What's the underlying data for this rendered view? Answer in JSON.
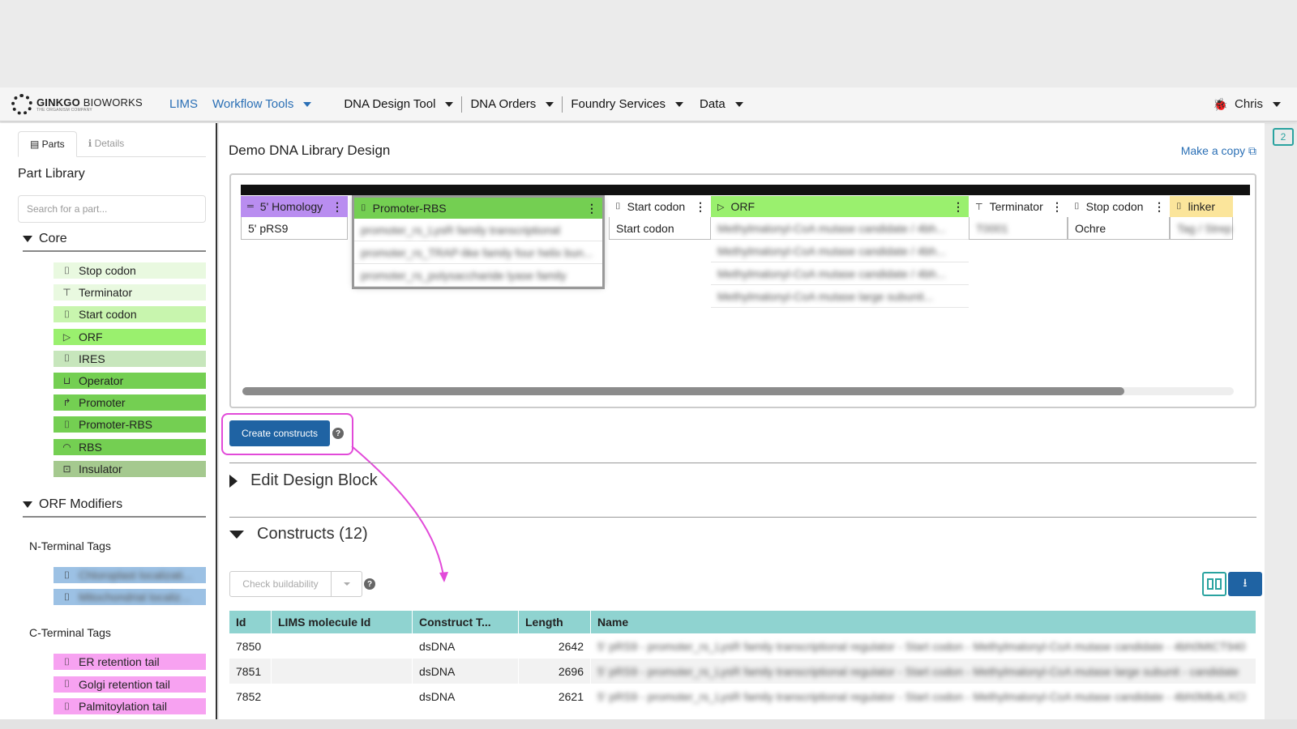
{
  "brand": {
    "name_bold": "GINKGO",
    "name_rest": " BIOWORKS",
    "tagline": "THE ORGANISM COMPANY"
  },
  "nav": {
    "lims": "LIMS",
    "workflow": "Workflow Tools",
    "items": [
      "DNA Design Tool",
      "DNA Orders",
      "Foundry Services",
      "Data"
    ],
    "user": "Chris"
  },
  "notifications": {
    "count": "2"
  },
  "sidebar": {
    "tabs": [
      "Parts",
      "Details"
    ],
    "title": "Part Library",
    "search_placeholder": "Search for a part...",
    "core_title": "Core",
    "core_parts": [
      {
        "label": "Stop codon",
        "icon": "bracket-icon",
        "glyph": "⌷",
        "color": "#e9f9e0"
      },
      {
        "label": "Terminator",
        "icon": "terminator-icon",
        "glyph": "⊤",
        "color": "#e9f9e0"
      },
      {
        "label": "Start codon",
        "icon": "bracket-icon",
        "glyph": "⌷",
        "color": "#c8f5ae"
      },
      {
        "label": "ORF",
        "icon": "orf-arrow-icon",
        "glyph": "▷",
        "color": "#9af06e"
      },
      {
        "label": "IRES",
        "icon": "bracket-icon",
        "glyph": "⌷",
        "color": "#c7e6bc"
      },
      {
        "label": "Operator",
        "icon": "operator-icon",
        "glyph": "⊔",
        "color": "#74cf52"
      },
      {
        "label": "Promoter",
        "icon": "promoter-arrow-icon",
        "glyph": "↱",
        "color": "#74cf52"
      },
      {
        "label": "Promoter-RBS",
        "icon": "bracket-icon",
        "glyph": "⌷",
        "color": "#74cf52"
      },
      {
        "label": "RBS",
        "icon": "rbs-icon",
        "glyph": "◠",
        "color": "#74cf52"
      },
      {
        "label": "Insulator",
        "icon": "insulator-icon",
        "glyph": "⊡",
        "color": "#a5c98f"
      }
    ],
    "orf_title": "ORF Modifiers",
    "n_terminal": "N-Terminal Tags",
    "n_parts": [
      {
        "label": "Chloroplast localizati...",
        "color": "#9cc1e4"
      },
      {
        "label": "Mitochondrial localiz...",
        "color": "#9cc1e4"
      }
    ],
    "c_terminal": "C-Terminal Tags",
    "c_parts": [
      {
        "label": "ER retention tail",
        "color": "#f7a2f1"
      },
      {
        "label": "Golgi retention tail",
        "color": "#f7a2f1"
      },
      {
        "label": "Palmitoylation tail",
        "color": "#f7a2f1"
      }
    ]
  },
  "main": {
    "title": "Demo DNA Library Design",
    "make_copy": "Make a copy",
    "columns": [
      {
        "head": "5' Homology",
        "color": "#b98df0",
        "cells": [
          "5' pRS9"
        ]
      },
      {
        "head": "Promoter-RBS",
        "color": "#74cf52",
        "cells": [
          "promoter_rs_LysR family transcriptional",
          "promoter_rs_TRAP-like family four helix bun...",
          "promoter_rs_polysaccharide lyase family"
        ]
      },
      {
        "head": "Start codon",
        "color": "#ffffff",
        "cells": [
          "Start codon"
        ]
      },
      {
        "head": "ORF",
        "color": "#9af06e",
        "cells": [
          "Methylmalonyl-CoA mutase candidate / 4bh...",
          "Methylmalonyl-CoA mutase candidate / 4bh...",
          "Methylmalonyl-CoA mutase candidate / 4bh...",
          "Methylmalonyl-CoA mutase large subunit..."
        ]
      },
      {
        "head": "Terminator",
        "color": "#ffffff",
        "cells": [
          "T0001"
        ]
      },
      {
        "head": "Stop codon",
        "color": "#ffffff",
        "cells": [
          "Ochre"
        ]
      },
      {
        "head": "linker",
        "color": "#fbe59b",
        "cells": [
          "Tag / Strep"
        ]
      }
    ],
    "create_label": "Create constructs",
    "edit_block": "Edit Design Block",
    "constructs": "Constructs (12)",
    "check_label": "Check buildability",
    "table": {
      "headers": [
        "Id",
        "LIMS molecule Id",
        "Construct T...",
        "Length",
        "Name"
      ],
      "rows": [
        {
          "id": "7850",
          "lims": "",
          "type": "dsDNA",
          "length": "2642",
          "name": "5' pRS9 - promoter_rs_LysR family transcriptional regulator - Start codon - Methylmalonyl-CoA mutase candidate - 4bh0MtCT940"
        },
        {
          "id": "7851",
          "lims": "",
          "type": "dsDNA",
          "length": "2696",
          "name": "5' pRS9 - promoter_rs_LysR family transcriptional regulator - Start codon - Methylmalonyl-CoA mutase large subunit - candidate"
        },
        {
          "id": "7852",
          "lims": "",
          "type": "dsDNA",
          "length": "2621",
          "name": "5' pRS9 - promoter_rs_LysR family transcriptional regulator - Start codon - Methylmalonyl-CoA mutase candidate - 4bh0Mb4LXCl"
        }
      ]
    }
  }
}
